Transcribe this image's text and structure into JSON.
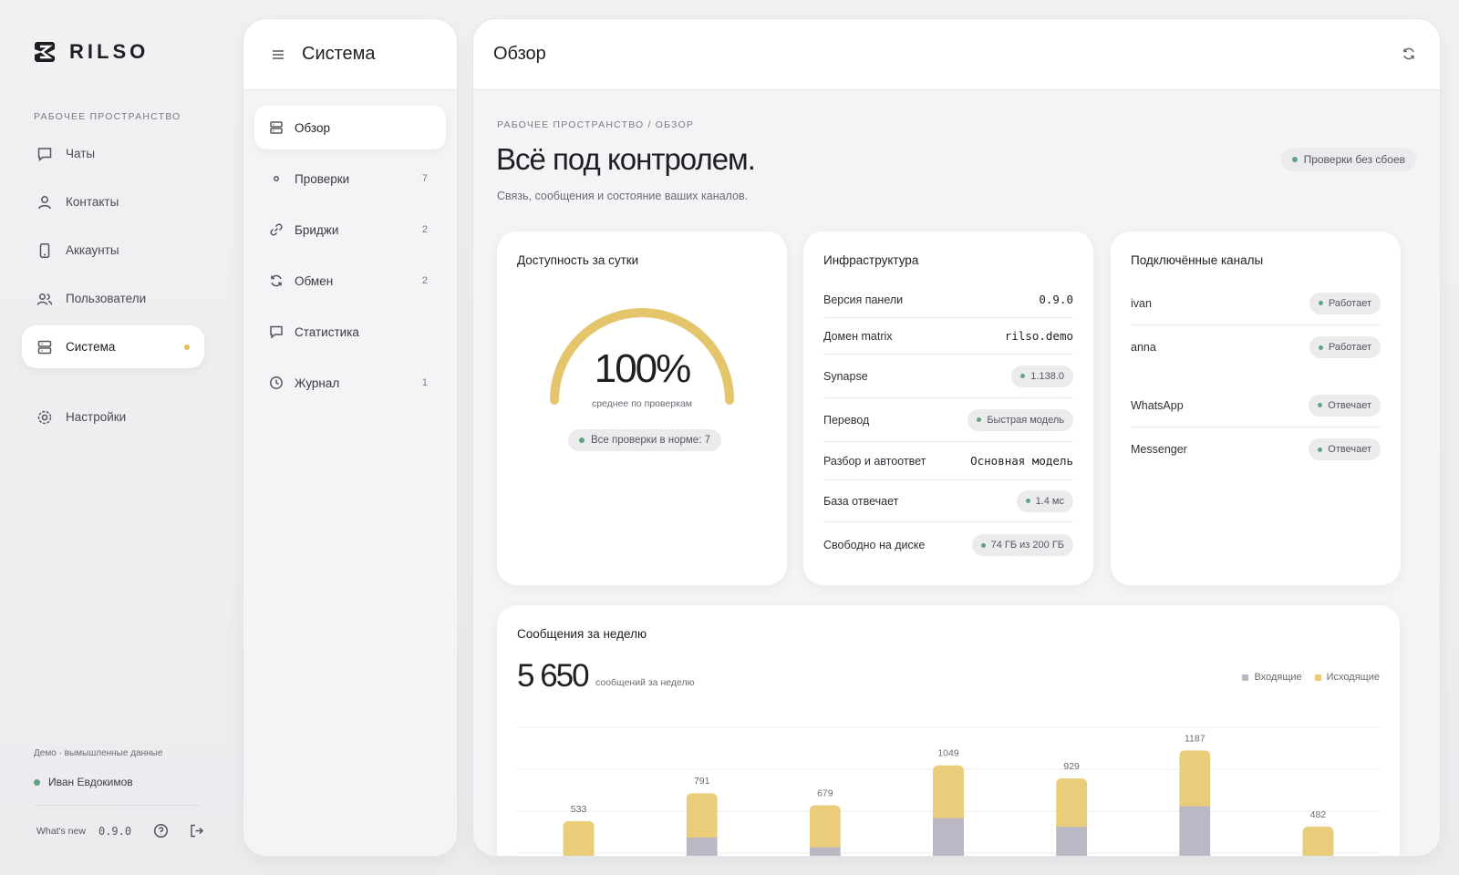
{
  "brand": {
    "name": "RILSO"
  },
  "rail": {
    "section_label": "РАБОЧЕЕ ПРОСТРАНСТВО",
    "items": [
      {
        "label": "Чаты",
        "icon": "chat-icon"
      },
      {
        "label": "Контакты",
        "icon": "user-icon"
      },
      {
        "label": "Аккаунты",
        "icon": "phone-icon"
      },
      {
        "label": "Пользователи",
        "icon": "users-icon"
      },
      {
        "label": "Система",
        "icon": "server-icon",
        "active": true
      }
    ],
    "settings_label": "Настройки",
    "demo_note": "Демо · вымышленные данные",
    "user_name": "Иван Евдокимов",
    "whats_new": "What's new",
    "version": "0.9.0"
  },
  "system_panel": {
    "title": "Система",
    "items": [
      {
        "label": "Обзор",
        "count": ""
      },
      {
        "label": "Проверки",
        "count": "7"
      },
      {
        "label": "Бриджи",
        "count": "2"
      },
      {
        "label": "Обмен",
        "count": "2"
      },
      {
        "label": "Статистика",
        "count": ""
      },
      {
        "label": "Журнал",
        "count": "1"
      }
    ]
  },
  "main": {
    "title": "Обзор",
    "breadcrumb": "РАБОЧЕЕ ПРОСТРАНСТВО / ОБЗОР",
    "headline": "Всё под контролем.",
    "subline": "Связь, сообщения и состояние ваших каналов.",
    "status_chip": "Проверки без сбоев"
  },
  "availability": {
    "title": "Доступность за сутки",
    "value": "100%",
    "fraction": 1.0,
    "caption": "среднее по проверкам",
    "chip": "Все проверки в норме: 7"
  },
  "infrastructure": {
    "title": "Инфраструктура",
    "rows": [
      {
        "label": "Версия панели",
        "value": "0.9.0",
        "kind": "mono"
      },
      {
        "label": "Домен matrix",
        "value": "rilso.demo",
        "kind": "mono"
      },
      {
        "label": "Synapse",
        "value": "1.138.0",
        "kind": "chip"
      },
      {
        "label": "Перевод",
        "value": "Быстрая модель",
        "kind": "chip"
      },
      {
        "label": "Разбор и автоответ",
        "value": "Основная модель",
        "kind": "mono"
      },
      {
        "label": "База отвечает",
        "value": "1.4 мс",
        "kind": "chip"
      },
      {
        "label": "Свободно на диске",
        "value": "74 ГБ из 200 ГБ",
        "kind": "chip"
      }
    ]
  },
  "channels": {
    "title": "Подключённые каналы",
    "rows": [
      {
        "name": "ivan",
        "status": "Работает"
      },
      {
        "name": "anna",
        "status": "Работает"
      },
      {
        "name": "WhatsApp",
        "status": "Отвечает"
      },
      {
        "name": "Messenger",
        "status": "Отвечает"
      }
    ]
  },
  "weekly": {
    "title": "Сообщения за неделю",
    "total": "5 650",
    "total_label": "сообщений за неделю",
    "legend": {
      "incoming": "Входящие",
      "outgoing": "Исходящие"
    }
  },
  "colors": {
    "accent": "#e4c15a",
    "incoming": "#b9b8c4",
    "outgoing": "#e9cd7a",
    "status_ok": "#5fa383"
  },
  "chart_data": {
    "type": "bar",
    "stacked": true,
    "totals": [
      533,
      791,
      679,
      1049,
      929,
      1187,
      482
    ],
    "series": [
      {
        "name": "Входящие",
        "values": [
          140,
          380,
          290,
          560,
          480,
          670,
          140
        ]
      },
      {
        "name": "Исходящие",
        "values": [
          393,
          411,
          389,
          489,
          449,
          517,
          342
        ]
      }
    ],
    "ylim": [
      0,
      1400
    ],
    "grid": true,
    "legend_position": "top-right"
  }
}
